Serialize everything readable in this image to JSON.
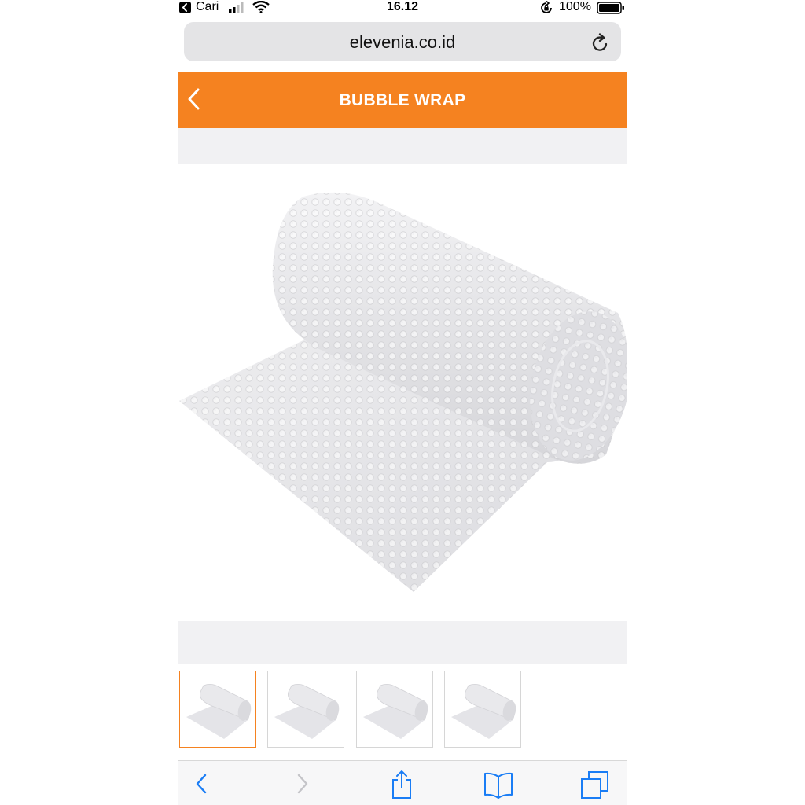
{
  "status_bar": {
    "back_app_label": "Cari",
    "time": "16.12",
    "battery_percent": "100%"
  },
  "browser": {
    "url": "elevenia.co.id"
  },
  "header": {
    "title": "BUBBLE WRAP"
  },
  "gallery": {
    "selected_index": 0,
    "thumbnail_count": 4
  },
  "colors": {
    "accent": "#f58220",
    "ios_blue": "#1a7df5"
  },
  "toolbar": {
    "icons": [
      "back-icon",
      "forward-icon",
      "share-icon",
      "bookmarks-icon",
      "tabs-icon"
    ]
  }
}
